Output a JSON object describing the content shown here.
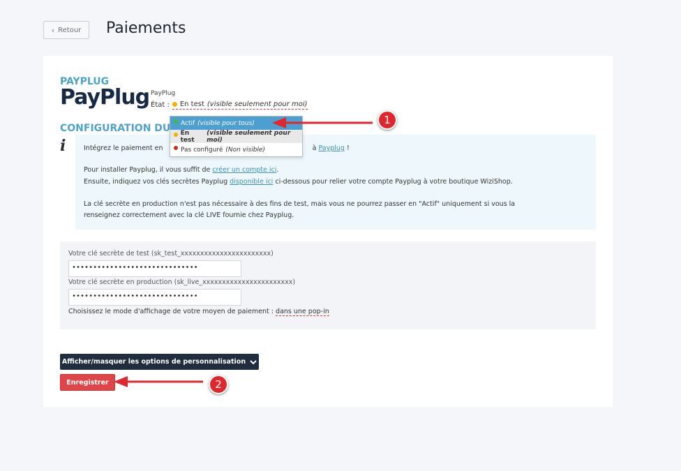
{
  "header": {
    "back_label": "Retour",
    "title": "Paiements"
  },
  "plugin": {
    "section_title": "PAYPLUG",
    "logo_text": "PayPlug",
    "name": "PayPlug",
    "state_label": "État :",
    "state_value": "En test",
    "state_value_note": "(visible seulement pour moi)"
  },
  "dropdown": {
    "options": [
      {
        "label": "Actif",
        "note": "(visible pour tous)",
        "color": "#3bbf3b"
      },
      {
        "label": "En test",
        "note": "(visible seulement pour moi)",
        "color": "#f0b400"
      },
      {
        "label": "Pas configuré",
        "note": "(Non visible)",
        "color": "#d42a1e"
      }
    ]
  },
  "config": {
    "section_title": "CONFIGURATION DU",
    "info_icon": "info-icon",
    "line1_a": "Intégrez le paiement en",
    "line1_b": "à",
    "line1_link": "Payplug",
    "line1_end": "!",
    "line2_a": "Pour installer Payplug, il vous suffit de",
    "line2_link": "créer un compte ici",
    "line2_end": ".",
    "line3_a": "Ensuite, indiquez vos clés secrètes Payplug",
    "line3_link": "disponible ici",
    "line3_b": "ci-dessous pour relier votre compte Payplug à votre boutique WiziShop.",
    "line4": "La clé secrète en production n'est pas nécessaire à des fins de test, mais vous ne pourrez passer en \"Actif\" uniquement si vous la",
    "line5": "renseignez correctement avec la clé LIVE fournie chez Payplug."
  },
  "form": {
    "test_key_label": "Votre clé secrète de test (sk_test_xxxxxxxxxxxxxxxxxxxxxxx)",
    "test_key_value": "••••••••••••••••••••••••••••••",
    "prod_key_label": "Votre clé secrète en production (sk_live_xxxxxxxxxxxxxxxxxxxxxxx)",
    "prod_key_value": "••••••••••••••••••••••••••••••",
    "mode_label": "Choisissez le mode d'affichage de votre moyen de paiement :",
    "mode_value": "dans une pop-in"
  },
  "actions": {
    "toggle_label": "Afficher/masquer les options de personnalisation",
    "save_label": "Enregistrer"
  },
  "annotations": {
    "callout1": "1",
    "callout2": "2",
    "arrow_color": "#e0272d"
  }
}
